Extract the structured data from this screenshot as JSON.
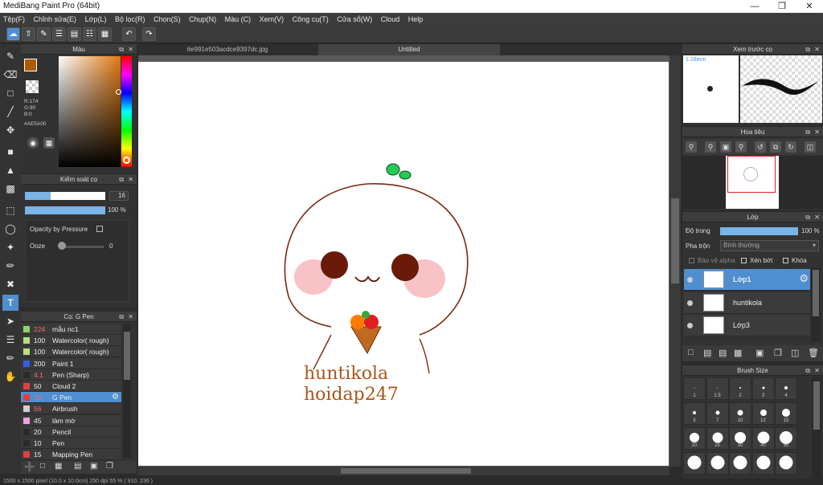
{
  "app": {
    "title": "MediBang Paint Pro (64bit)"
  },
  "menu": [
    "Tệp(F)",
    "Chỉnh sửa(E)",
    "Lớp(L)",
    "Bộ lọc(R)",
    "Chọn(S)",
    "Chụp(N)",
    "Màu (C)",
    "Xem(V)",
    "Công cụ(T)",
    "Cửa sổ(W)",
    "Cloud",
    "Help"
  ],
  "documents": {
    "tab1": "6e991e503acdce9397dc.jpg",
    "tab2": "Untitled"
  },
  "color_panel": {
    "title": "Màu",
    "rgb": {
      "r": "R:174",
      "g": "G:90",
      "b": "B:0"
    },
    "hex": "#AE5A00",
    "colors": {
      "foreground": "#AE5A00",
      "background": "#ffffff"
    }
  },
  "brush_control": {
    "title": "Kiểm soát cọ",
    "size_value": "16",
    "opacity_value": "100 %",
    "opacity_by_pressure": "Opacity by Pressure",
    "ooze_label": "Ooze",
    "ooze_value": "0"
  },
  "brush_panel": {
    "title": "Cọ: G Pen",
    "items": [
      {
        "size": "224",
        "name": "mẫu nc1",
        "color": "#8fd36b",
        "size_red": true
      },
      {
        "size": "100",
        "name": "Watercolor( rough)",
        "color": "#b8e07a",
        "size_red": false
      },
      {
        "size": "100",
        "name": "Watercolor( rough)",
        "color": "#b8e07a",
        "size_red": false
      },
      {
        "size": "200",
        "name": "Paint 1",
        "color": "#3a5ee0",
        "size_red": false
      },
      {
        "size": "4.1",
        "name": "Pen (Sharp)",
        "color": "#2a2a2a",
        "size_red": true
      },
      {
        "size": "50",
        "name": "Cloud 2",
        "color": "#e04040",
        "size_red": false
      },
      {
        "size": "16",
        "name": "G Pen",
        "color": "#e04040",
        "size_red": true,
        "selected": true
      },
      {
        "size": "56",
        "name": "Airbrush",
        "color": "#d0d0d0",
        "size_red": true
      },
      {
        "size": "45",
        "name": "làm mờ",
        "color": "#f0a0e0",
        "size_red": false
      },
      {
        "size": "20",
        "name": "Pencil",
        "color": "#2a2a2a",
        "size_red": false
      },
      {
        "size": "10",
        "name": "Pen",
        "color": "#2a2a2a",
        "size_red": false
      },
      {
        "size": "15",
        "name": "Mapping Pen",
        "color": "#e04040",
        "size_red": false
      }
    ]
  },
  "preview_panel": {
    "title": "Xem trước cọ",
    "size_text": "1.18mm"
  },
  "navigator_panel": {
    "title": "Hoa tiêu"
  },
  "layer_panel": {
    "title": "Lớp",
    "opacity_label": "Độ trong",
    "opacity_value": "100 %",
    "blend_label": "Pha trộn",
    "blend_value": "Bình thường",
    "protect_alpha": "Bảo vệ alpha",
    "clipping": "Xén bớt",
    "lock": "Khóa",
    "layers": [
      {
        "name": "Lớp1",
        "selected": true
      },
      {
        "name": "huntikola",
        "selected": false
      },
      {
        "name": "Lớp3",
        "selected": false
      }
    ]
  },
  "brush_size_panel": {
    "title": "Brush Size",
    "sizes": [
      "1",
      "1.5",
      "2",
      "3",
      "4",
      "5",
      "7",
      "10",
      "12",
      "15",
      "20",
      "25",
      "30",
      "40",
      "50"
    ]
  },
  "canvas_text": {
    "line1": "huntikola",
    "line2": "hoidap247"
  },
  "status": "1500 x 1500 pixel   (10.0 x 10.0cm)   250 dpi   55 %   ( 910, 236 )"
}
